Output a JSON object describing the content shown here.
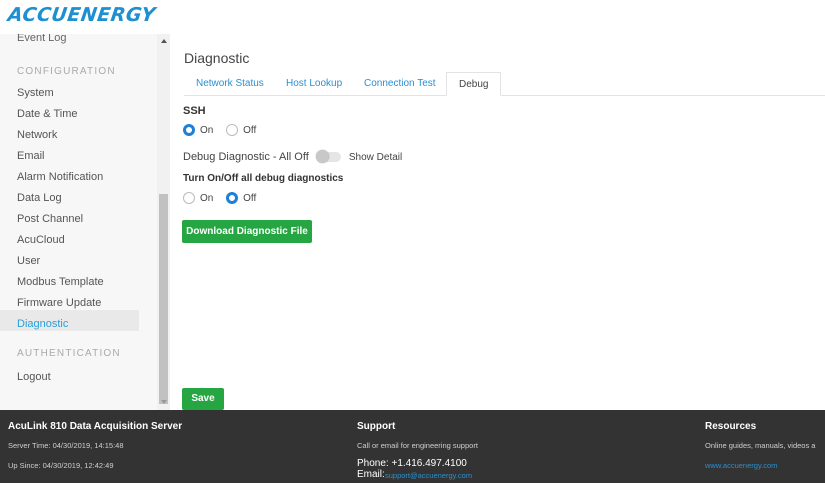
{
  "header": {
    "logo_text": "ACCUENERGY"
  },
  "sidebar": {
    "top_item": "Event Log",
    "section_configuration": "CONFIGURATION",
    "items": [
      "System",
      "Date & Time",
      "Network",
      "Email",
      "Alarm Notification",
      "Data Log",
      "Post Channel",
      "AcuCloud",
      "User",
      "Modbus Template",
      "Firmware Update",
      "Diagnostic"
    ],
    "active_item": "Diagnostic",
    "section_authentication": "AUTHENTICATION",
    "logout": "Logout"
  },
  "main": {
    "title": "Diagnostic",
    "tabs": [
      {
        "label": "Network Status"
      },
      {
        "label": "Host Lookup"
      },
      {
        "label": "Connection Test"
      },
      {
        "label": "Debug"
      }
    ],
    "active_tab": "Debug",
    "ssh": {
      "label": "SSH",
      "options": [
        "On",
        "Off"
      ],
      "selected": "On"
    },
    "debug_diagnostic": {
      "label": "Debug Diagnostic - All Off",
      "show_detail": "Show Detail",
      "toggle_on": false
    },
    "debug_all": {
      "label": "Turn On/Off all debug diagnostics",
      "options": [
        "On",
        "Off"
      ],
      "selected": "Off"
    },
    "download_button": "Download Diagnostic File",
    "save_button": "Save"
  },
  "footer": {
    "col1": {
      "title": "AcuLink 810 Data Acquisition Server",
      "server_time": "Server Time: 04/30/2019, 14:15:48",
      "up_since": "Up Since: 04/30/2019, 12:42:49"
    },
    "col2": {
      "title": "Support",
      "text": "Call or email for engineering support",
      "phone": "Phone: +1.416.497.4100",
      "email_label": "Email:",
      "email": "support@accuenergy.com"
    },
    "col3": {
      "title": "Resources",
      "text": "Online guides, manuals, videos a",
      "link": "www.accuenergy.com"
    }
  },
  "colors": {
    "accent_blue": "#2a8fd0",
    "radio_blue": "#1e7fd6",
    "button_green": "#26a642",
    "footer_bg": "#333333"
  }
}
